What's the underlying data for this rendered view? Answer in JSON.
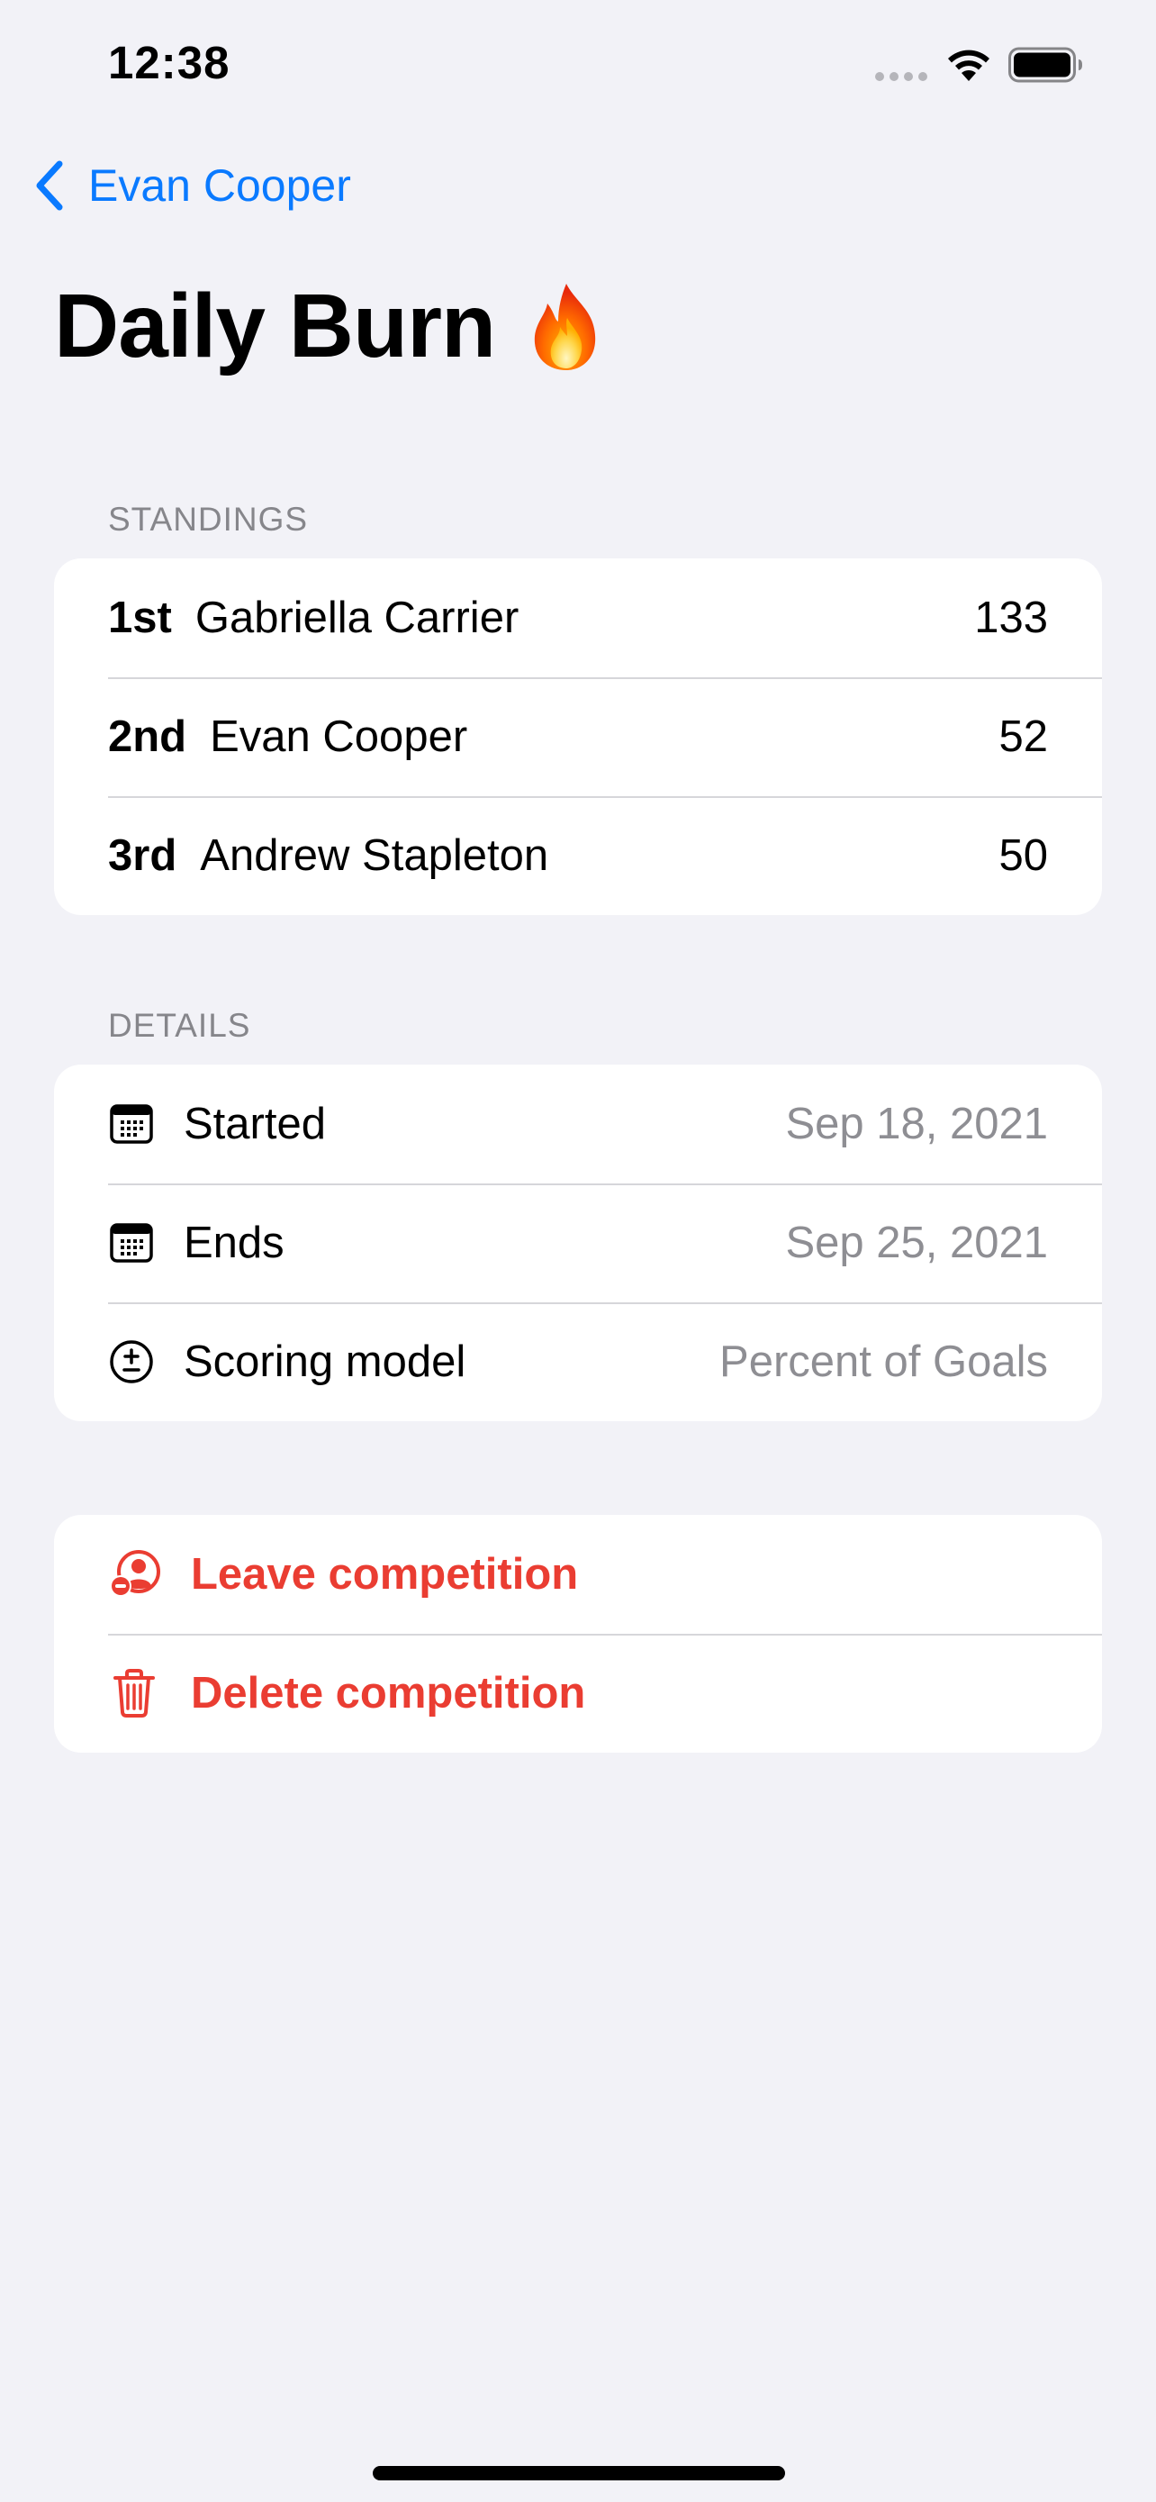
{
  "status_bar": {
    "time": "12:38"
  },
  "nav": {
    "back_label": "Evan Cooper"
  },
  "page": {
    "title": "Daily Burn",
    "title_emoji_icon": "fire-icon"
  },
  "standings": {
    "header": "STANDINGS",
    "rows": [
      {
        "rank": "1st",
        "name": "Gabriella Carrier",
        "score": "133"
      },
      {
        "rank": "2nd",
        "name": "Evan Cooper",
        "score": "52"
      },
      {
        "rank": "3rd",
        "name": "Andrew Stapleton",
        "score": "50"
      }
    ]
  },
  "details": {
    "header": "DETAILS",
    "rows": [
      {
        "icon": "calendar-icon",
        "label": "Started",
        "value": "Sep 18, 2021"
      },
      {
        "icon": "calendar-icon",
        "label": "Ends",
        "value": "Sep 25, 2021"
      },
      {
        "icon": "plus-minus-circle-icon",
        "label": "Scoring model",
        "value": "Percent of Goals"
      }
    ]
  },
  "actions": {
    "leave_label": "Leave competition",
    "delete_label": "Delete competition"
  },
  "colors": {
    "accent": "#0a7aff",
    "destructive": "#ea3d32",
    "background": "#f2f2f7",
    "secondary_text": "#8e8e93"
  }
}
